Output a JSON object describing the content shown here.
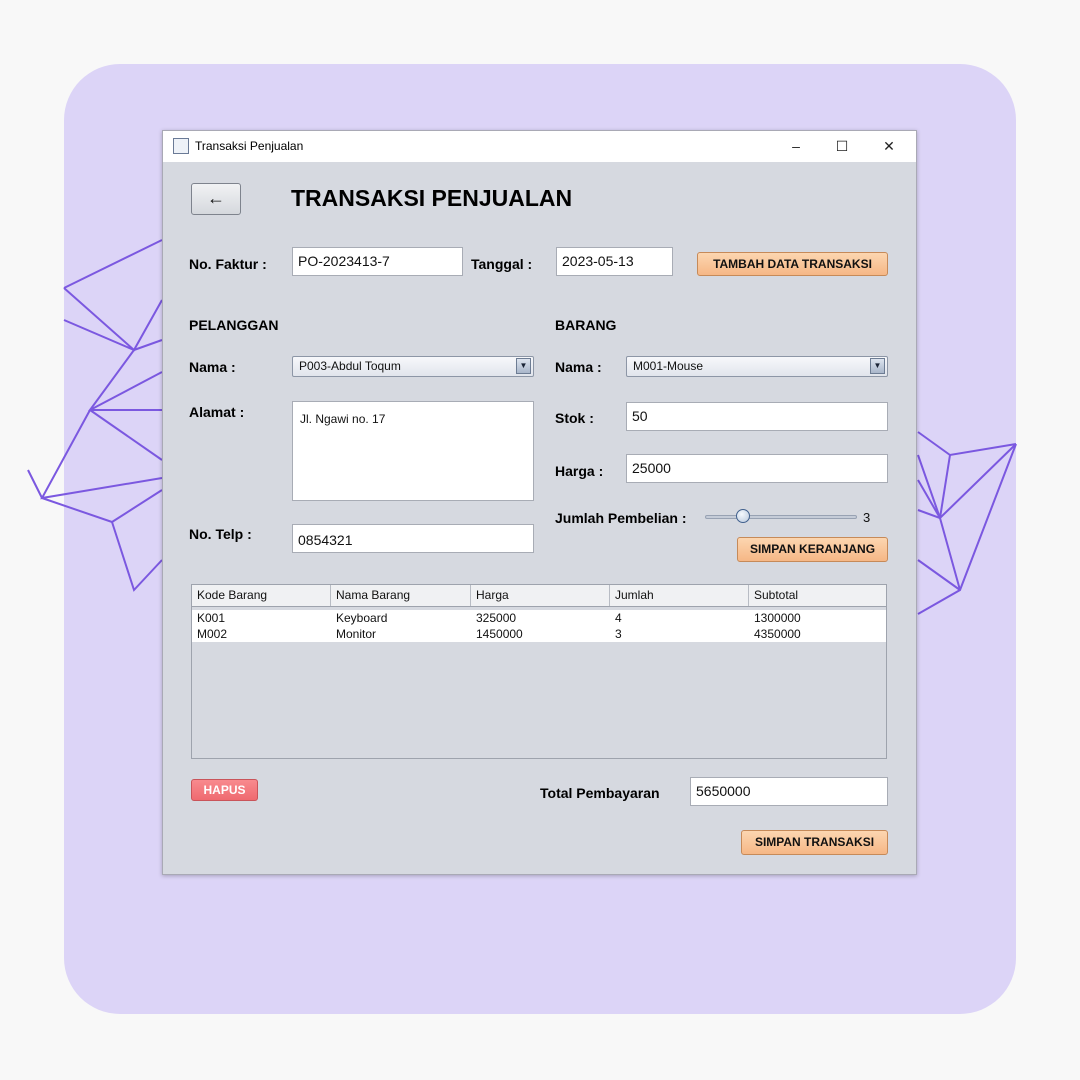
{
  "window": {
    "title": "Transaksi Penjualan",
    "controls": {
      "minimize": "–",
      "maximize": "☐",
      "close": "✕"
    }
  },
  "header": {
    "back_glyph": "←",
    "title": "TRANSAKSI PENJUALAN"
  },
  "faktur": {
    "label": "No. Faktur :",
    "value": "PO-2023413-7",
    "tanggal_label": "Tanggal :",
    "tanggal_value": "2023-05-13",
    "add_button": "TAMBAH DATA TRANSAKSI"
  },
  "pelanggan": {
    "section": "PELANGGAN",
    "nama_label": "Nama :",
    "nama_value": "P003-Abdul Toqum",
    "alamat_label": "Alamat :",
    "alamat_value": "Jl. Ngawi no. 17",
    "telp_label": "No. Telp :",
    "telp_value": "0854321"
  },
  "barang": {
    "section": "BARANG",
    "nama_label": "Nama :",
    "nama_value": "M001-Mouse",
    "stok_label": "Stok :",
    "stok_value": "50",
    "harga_label": "Harga :",
    "harga_value": "25000",
    "jumlah_label": "Jumlah Pembelian :",
    "jumlah_value": "3",
    "slider_fraction": 0.25,
    "cart_button": "SIMPAN KERANJANG"
  },
  "table": {
    "columns": [
      "Kode Barang",
      "Nama Barang",
      "Harga",
      "Jumlah",
      "Subtotal"
    ],
    "rows": [
      [
        "K001",
        "Keyboard",
        "325000",
        "4",
        "1300000"
      ],
      [
        "M002",
        "Monitor",
        "1450000",
        "3",
        "4350000"
      ]
    ]
  },
  "footer": {
    "delete_button": "HAPUS",
    "total_label": "Total Pembayaran",
    "total_value": "5650000",
    "save_button": "SIMPAN TRANSAKSI"
  },
  "colors": {
    "card": "#dcd4f7",
    "decoration_lines": "#7b58e0",
    "orange_button": "#f6b786",
    "red_button": "#ef6a70",
    "window_bg": "#d6d9e0"
  }
}
